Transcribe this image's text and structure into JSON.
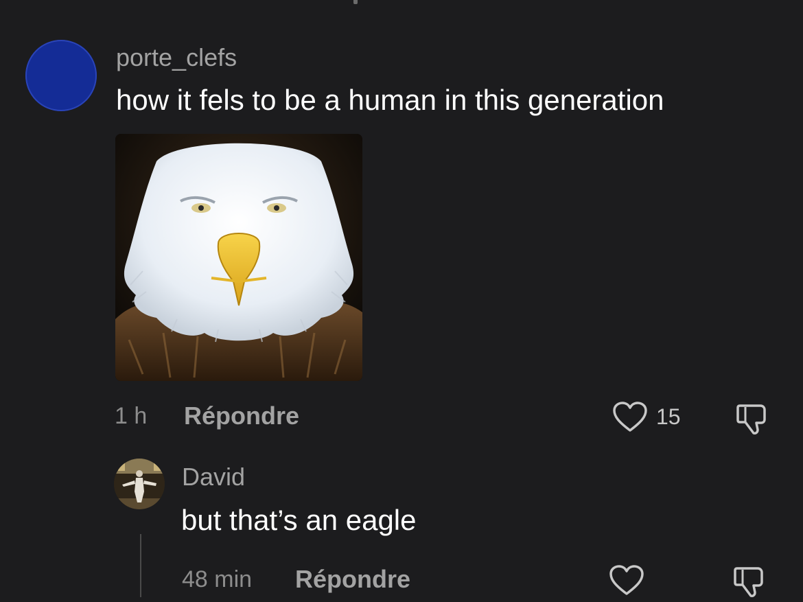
{
  "comment": {
    "username": "porte_clefs",
    "text": "how it fels to be a human in this generation",
    "time": "1 h",
    "reply_label": "Répondre",
    "likes": "15",
    "avatar_color": "#142c96"
  },
  "reply": {
    "username": "David",
    "text": "but that’s an eagle",
    "time": "48 min",
    "reply_label": "Répondre"
  },
  "icons": {
    "like": "heart-outline-icon",
    "dislike": "thumbs-down-outline-icon"
  }
}
